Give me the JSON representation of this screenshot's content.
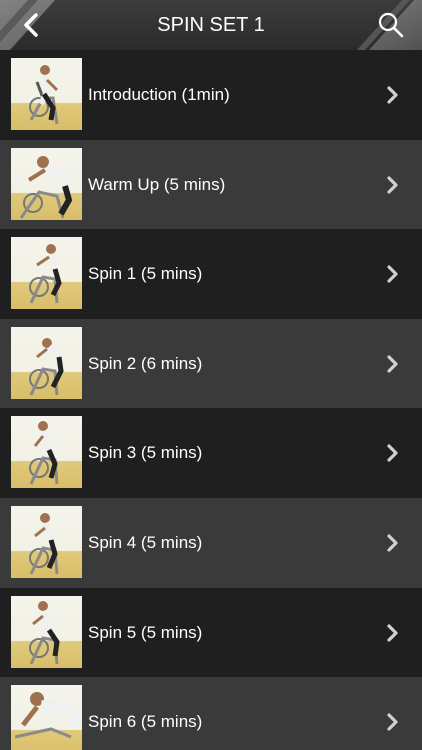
{
  "header": {
    "title": "SPIN SET 1",
    "back_icon": "chevron-left-icon",
    "search_icon": "search-icon"
  },
  "colors": {
    "header_bg": "#333333",
    "row_dark": "#1f1f1f",
    "row_light": "#3a3a3a",
    "text": "#ffffff"
  },
  "items": [
    {
      "label": "Introduction (1min)"
    },
    {
      "label": "Warm Up (5 mins)"
    },
    {
      "label": "Spin 1 (5 mins)"
    },
    {
      "label": "Spin 2 (6 mins)"
    },
    {
      "label": "Spin 3 (5 mins)"
    },
    {
      "label": "Spin 4 (5 mins)"
    },
    {
      "label": "Spin 5 (5 mins)"
    },
    {
      "label": "Spin 6 (5 mins)"
    }
  ]
}
